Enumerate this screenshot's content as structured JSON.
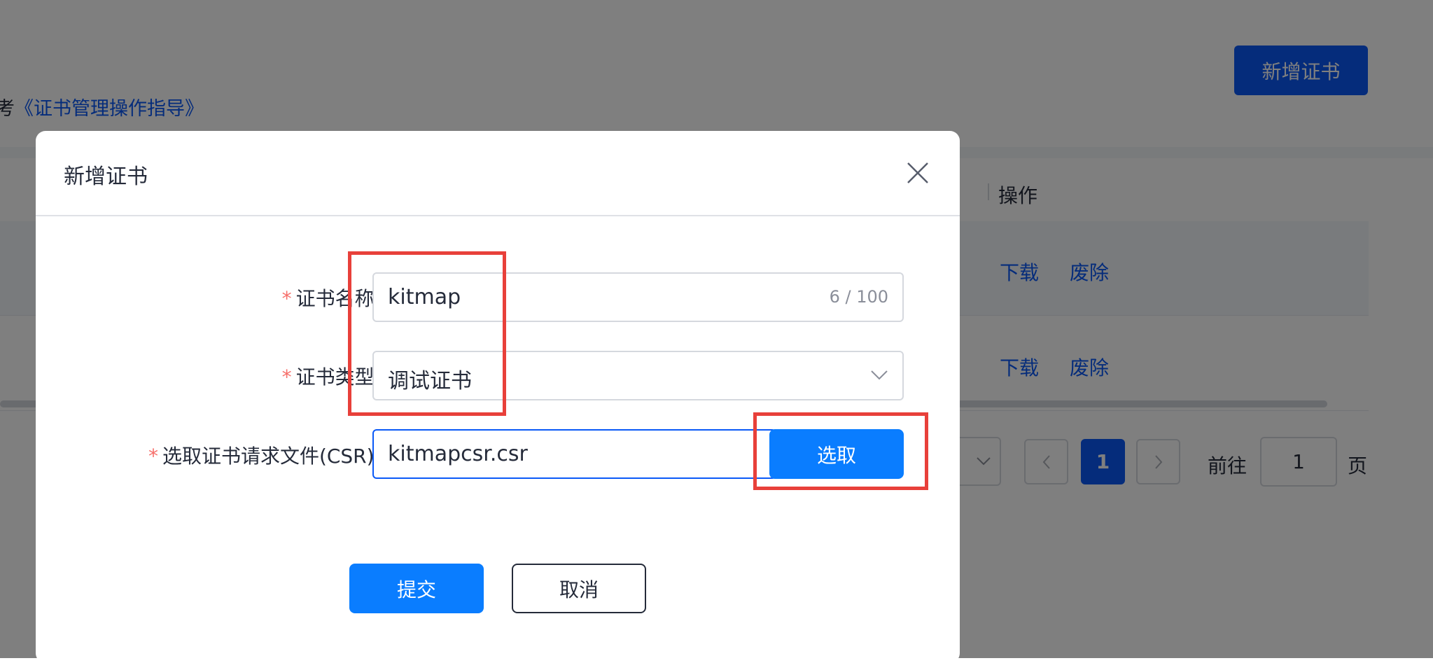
{
  "background": {
    "hint_prefix": "考",
    "hint_link": "《证书管理操作指导》",
    "add_button": "新增证书",
    "table_header_action": "操作",
    "rows": [
      {
        "download": "下载",
        "revoke": "废除"
      },
      {
        "download": "下载",
        "revoke": "废除"
      }
    ],
    "pagination": {
      "prev_icon": "chevron-left-icon",
      "next_icon": "chevron-right-icon",
      "current_page": "1",
      "goto_label": "前往",
      "goto_value": "1",
      "page_suffix": "页"
    }
  },
  "dialog": {
    "title": "新增证书",
    "close_icon": "close-icon",
    "required_mark": "*",
    "fields": {
      "name": {
        "label": "证书名称:",
        "value": "kitmap",
        "counter": "6 / 100"
      },
      "type": {
        "label": "证书类型:",
        "value": "调试证书",
        "icon": "chevron-down-icon"
      },
      "csr": {
        "label": "选取证书请求文件(CSR):",
        "value": "kitmapcsr.csr",
        "select_button": "选取"
      }
    },
    "submit_button": "提交",
    "cancel_button": "取消"
  },
  "colors": {
    "primary": "#0a7dff",
    "brand": "#0a59f7",
    "required": "#f66f6a",
    "annotation": "#e8403a",
    "mask": "rgba(0,0,0,0.5)"
  }
}
